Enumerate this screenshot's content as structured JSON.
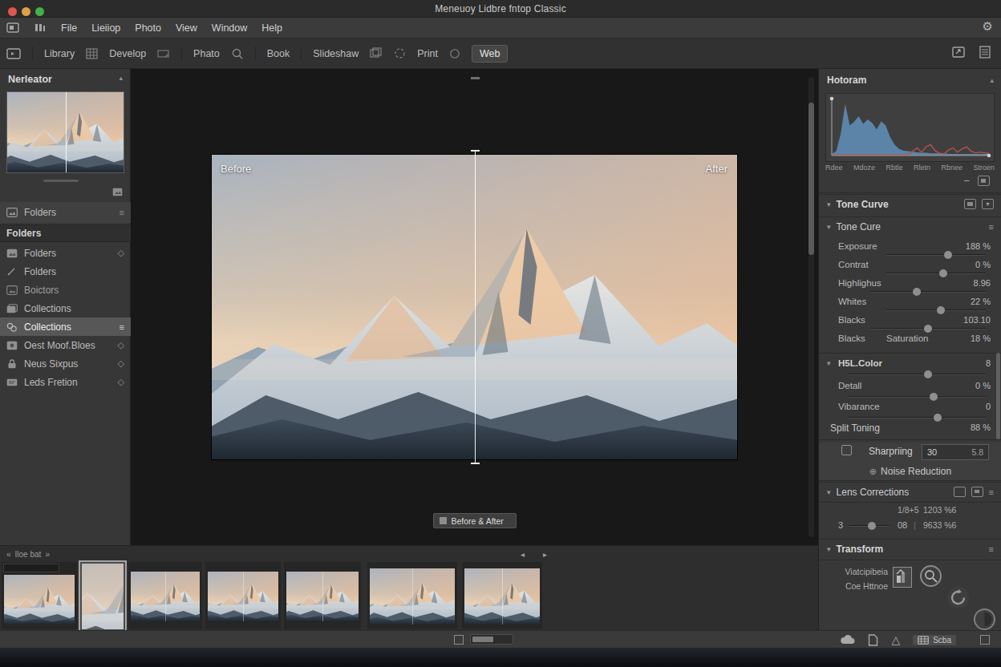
{
  "window": {
    "title": "Meneuoy Lidbre fntop Classic",
    "traffic_lights": [
      "#e0554d",
      "#dfa046",
      "#43b04a"
    ]
  },
  "menu_bar": {
    "items": [
      "File",
      "Lieiiop",
      "Photo",
      "View",
      "Window",
      "Help"
    ]
  },
  "module_bar": {
    "items": [
      {
        "label": "Library"
      },
      {
        "label": "Develop"
      },
      {
        "label": "Phato"
      },
      {
        "label": "Book"
      },
      {
        "label": "Slideshaw"
      },
      {
        "label": "Print"
      },
      {
        "label": "Web"
      }
    ],
    "active": "Web"
  },
  "left_panel": {
    "navigator_title": "Nerleator",
    "top_row": "Folders",
    "section_label": "Folders",
    "items": [
      {
        "label": "Folders"
      },
      {
        "label": "Folders"
      },
      {
        "label": "Boictors"
      },
      {
        "label": "Collections"
      },
      {
        "label": "Collections",
        "selected": true
      },
      {
        "label": "Oest Moof.Bloes"
      },
      {
        "label": "Neus Sixpus"
      },
      {
        "label": "Leds Fretion"
      }
    ]
  },
  "canvas": {
    "before_label": "Before",
    "after_label": "After",
    "compare_button": "Before & After"
  },
  "right_panel": {
    "histogram_title": "Hotoram",
    "tone_curve_title": "Tone Curve",
    "tone_cure_title": "Tone Cure",
    "sliders": [
      {
        "label": "Exposure",
        "value": "188 %",
        "pos": 62
      },
      {
        "label": "Contrat",
        "value": "0 %",
        "pos": 57
      },
      {
        "label": "Highlighus",
        "value": "8.96",
        "pos": 40
      },
      {
        "label": "Whites",
        "value": "22 %",
        "pos": 55
      },
      {
        "label": "Blacks",
        "value": "103.10",
        "pos": 50
      }
    ],
    "blacks_sat_row": {
      "label1": "Blacks",
      "label2": "Saturation",
      "value": "18 %"
    },
    "hsl": {
      "title": "H5L.Color",
      "value": "8",
      "pos": 58,
      "detail": {
        "label": "Detall",
        "value": "0 %",
        "pos": 62
      },
      "vibrance": {
        "label": "Vibarance",
        "value": "0",
        "pos": 65
      },
      "split": {
        "label": "Split Toning",
        "value": "88 %"
      }
    },
    "sharpening": {
      "label": "Sharpriing",
      "input": "30",
      "value": "5.8"
    },
    "noise_reduction": "Noise Reduction",
    "lens": {
      "title": "Lens Corrections",
      "val_a": "1/8+5",
      "val_b": "1203 %6",
      "val_c": "3",
      "val_d": "08",
      "val_e": "9633 %6",
      "pos": 55
    },
    "transform": {
      "title": "Transform",
      "line1": "Viatcipibeia",
      "line2": "Coe Httnoe"
    }
  },
  "filmstrip": {
    "label": "Iloe bat"
  },
  "bottom_bar": {
    "status": "Scba"
  },
  "icons": {
    "gear": "⚙",
    "panel_end": "▴",
    "chev_down": "▾",
    "diamond": "◇",
    "menu": "≡",
    "minus": "−",
    "plus_circle": "⊕",
    "laquo": "«",
    "raquo": "»",
    "prev": "◂",
    "next": "▸",
    "triangle": "△",
    "pipe": "|"
  },
  "chart_data": {
    "type": "area",
    "title": "Hotoram",
    "x_labels": [
      "Rdee",
      "Mdoze",
      "Rbtle",
      "Rletn",
      "Rbnee",
      "Stroen"
    ],
    "ylim": [
      0,
      100
    ],
    "grid": false,
    "series": [
      {
        "name": "luminance-histogram",
        "color": "#5b84a8",
        "values": [
          3,
          8,
          40,
          95,
          55,
          62,
          72,
          58,
          66,
          60,
          48,
          63,
          55,
          34,
          20,
          12,
          9,
          8,
          7,
          6,
          5,
          5,
          4,
          4,
          4,
          4,
          3,
          3,
          3,
          3,
          3,
          3,
          3,
          3,
          3,
          3
        ]
      },
      {
        "name": "red-channel-overlay",
        "color": "#b5524b",
        "values": [
          1,
          1,
          1,
          1,
          1,
          1,
          1,
          1,
          1,
          1,
          1,
          1,
          1,
          1,
          1,
          1,
          1,
          2,
          8,
          14,
          6,
          16,
          20,
          9,
          4,
          3,
          10,
          14,
          6,
          12,
          16,
          8,
          5,
          6,
          5,
          4
        ]
      }
    ]
  }
}
